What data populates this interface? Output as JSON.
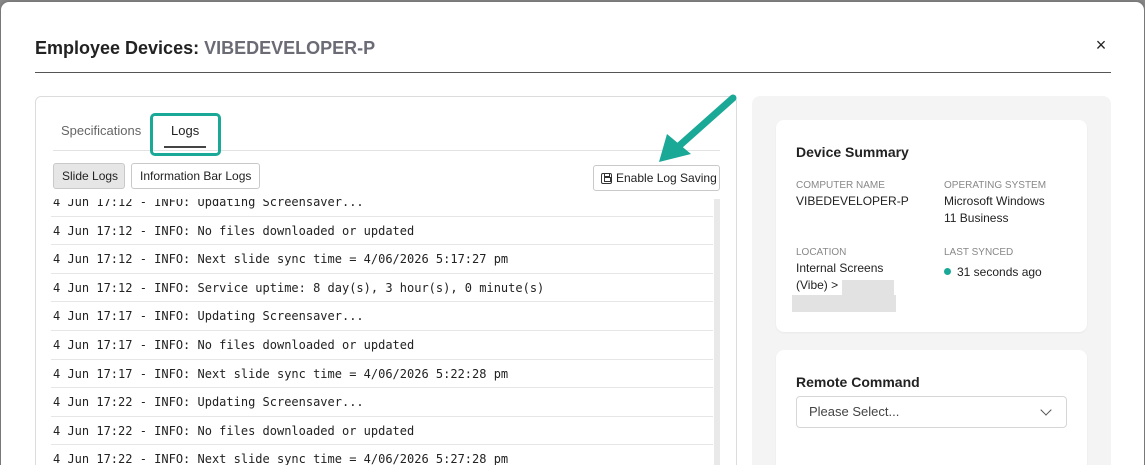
{
  "modal": {
    "title_prefix": "Employee Devices:",
    "device_name": "VIBEDEVELOPER-P",
    "close_glyph": "×"
  },
  "tabs": [
    {
      "label": "Specifications",
      "active": false
    },
    {
      "label": "Logs",
      "active": true
    }
  ],
  "log_buttons": {
    "slide_logs": "Slide Logs",
    "info_bar_logs": "Information Bar Logs",
    "enable_saving": "Enable Log Saving",
    "enable_icon": "save-icon"
  },
  "logs": [
    "4 Jun 17:12 - INFO: Updating Screensaver...",
    "4 Jun 17:12 - INFO: No files downloaded or updated",
    "4 Jun 17:12 - INFO: Next slide sync time = 4/06/2026 5:17:27 pm",
    "4 Jun 17:12 - INFO: Service uptime: 8 day(s), 3 hour(s), 0 minute(s)",
    "4 Jun 17:17 - INFO: Updating Screensaver...",
    "4 Jun 17:17 - INFO: No files downloaded or updated",
    "4 Jun 17:17 - INFO: Next slide sync time = 4/06/2026 5:22:28 pm",
    "4 Jun 17:22 - INFO: Updating Screensaver...",
    "4 Jun 17:22 - INFO: No files downloaded or updated",
    "4 Jun 17:22 - INFO: Next slide sync time = 4/06/2026 5:27:28 pm"
  ],
  "summary": {
    "title": "Device Summary",
    "computer_name_label": "COMPUTER NAME",
    "computer_name": "VIBEDEVELOPER-P",
    "os_label": "OPERATING SYSTEM",
    "os_line1": "Microsoft Windows",
    "os_line2": "11 Business",
    "location_label": "LOCATION",
    "location_line1": "Internal Screens",
    "location_line2": "(Vibe) >",
    "last_synced_label": "LAST SYNCED",
    "last_synced": "31 seconds ago",
    "status_color": "#1aa897"
  },
  "remote": {
    "title": "Remote Command",
    "select_placeholder": "Please Select..."
  },
  "colors": {
    "accent": "#1aa897",
    "overlay": "#8a8a8a"
  }
}
